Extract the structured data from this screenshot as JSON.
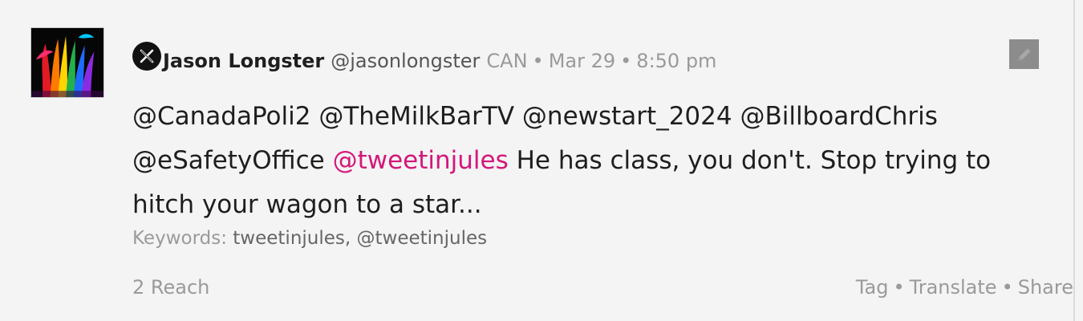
{
  "post": {
    "author": {
      "name": "Jason Longster",
      "handle": "@jasonlongster"
    },
    "country": "CAN",
    "date": "Mar 29",
    "time": "8:50 pm",
    "separator": "•",
    "body": {
      "mentions_line": [
        "@CanadaPoli2",
        "@TheMilkBarTV",
        "@newstart_2024",
        "@BillboardChris",
        "@eSafetyOffice"
      ],
      "highlighted_mention": "@tweetinjules",
      "text": "He has class, you don't. Stop trying to hitch your wagon to a star..."
    },
    "keywords": {
      "label": "Keywords:",
      "values": "tweetinjules, @tweetinjules"
    },
    "reach": "2 Reach",
    "actions": {
      "tag": "Tag",
      "translate": "Translate",
      "share": "Share"
    }
  },
  "colors": {
    "highlight": "#d4177a",
    "muted": "#9a9a9a",
    "background": "#f4f4f4"
  },
  "icons": {
    "platform": "x-logo-icon",
    "edit": "edit-pencil-icon"
  }
}
